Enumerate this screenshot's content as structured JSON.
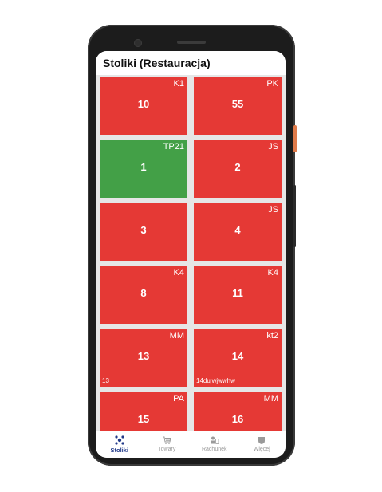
{
  "app": {
    "title": "Stoliki (Restauracja)"
  },
  "colors": {
    "occupied": "#e53935",
    "free": "#43a047",
    "active_nav": "#223a8a"
  },
  "tables": [
    {
      "number": "10",
      "code": "K1",
      "note": "",
      "status": "occupied"
    },
    {
      "number": "55",
      "code": "PK",
      "note": "",
      "status": "occupied"
    },
    {
      "number": "1",
      "code": "TP21",
      "note": "",
      "status": "free"
    },
    {
      "number": "2",
      "code": "JS",
      "note": "",
      "status": "occupied"
    },
    {
      "number": "3",
      "code": "",
      "note": "",
      "status": "occupied"
    },
    {
      "number": "4",
      "code": "JS",
      "note": "",
      "status": "occupied"
    },
    {
      "number": "8",
      "code": "K4",
      "note": "",
      "status": "occupied"
    },
    {
      "number": "11",
      "code": "K4",
      "note": "",
      "status": "occupied"
    },
    {
      "number": "13",
      "code": "MM",
      "note": "13",
      "status": "occupied"
    },
    {
      "number": "14",
      "code": "kt2",
      "note": "14dujwjwwhw",
      "status": "occupied"
    },
    {
      "number": "15",
      "code": "PA",
      "note": "",
      "status": "occupied"
    },
    {
      "number": "16",
      "code": "MM",
      "note": "",
      "status": "occupied"
    }
  ],
  "nav": [
    {
      "label": "Stoliki",
      "icon": "tables-icon",
      "active": true
    },
    {
      "label": "Towary",
      "icon": "cart-icon",
      "active": false
    },
    {
      "label": "Rachunek",
      "icon": "receipt-icon",
      "active": false
    },
    {
      "label": "Więcej",
      "icon": "more-icon",
      "active": false
    }
  ]
}
